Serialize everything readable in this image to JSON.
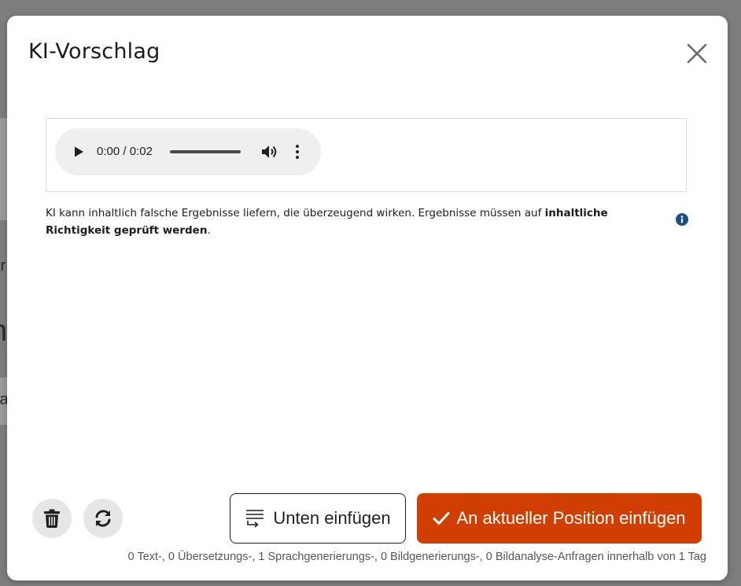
{
  "background": {
    "fragments": [
      "ir",
      "n",
      "fa"
    ]
  },
  "modal": {
    "title": "KI-Vorschlag",
    "close_icon": "close-icon"
  },
  "audio": {
    "current_time": "0:00",
    "separator": "/",
    "duration": "0:02",
    "progress": 0,
    "icons": [
      "play-icon",
      "volume-icon",
      "more-vertical-icon"
    ]
  },
  "disclaimer": {
    "text": "KI kann inhaltlich falsche Ergebnisse liefern, die überzeugend wirken. Ergebnisse müssen auf ",
    "bold": "inhaltliche Richtigkeit geprüft werden",
    "end": ".",
    "icon": "info-icon"
  },
  "actions": {
    "delete_icon": "trash-icon",
    "regenerate_icon": "refresh-icon",
    "insert_below_label": "Unten einfügen",
    "insert_below_icon": "insert-below-icon",
    "insert_current_label": "An aktueller Position einfügen",
    "insert_current_icon": "check-icon"
  },
  "quota": {
    "text": "0 Text-, 0 Übersetzungs-, 1 Sprachgenerierungs-, 0 Bildgenerierungs-, 0 Bildanalyse-Anfragen innerhalb von 1 Tag"
  },
  "colors": {
    "primary": "#d13f00",
    "overlay": "#7d7d7d",
    "info": "#1d4e89"
  }
}
